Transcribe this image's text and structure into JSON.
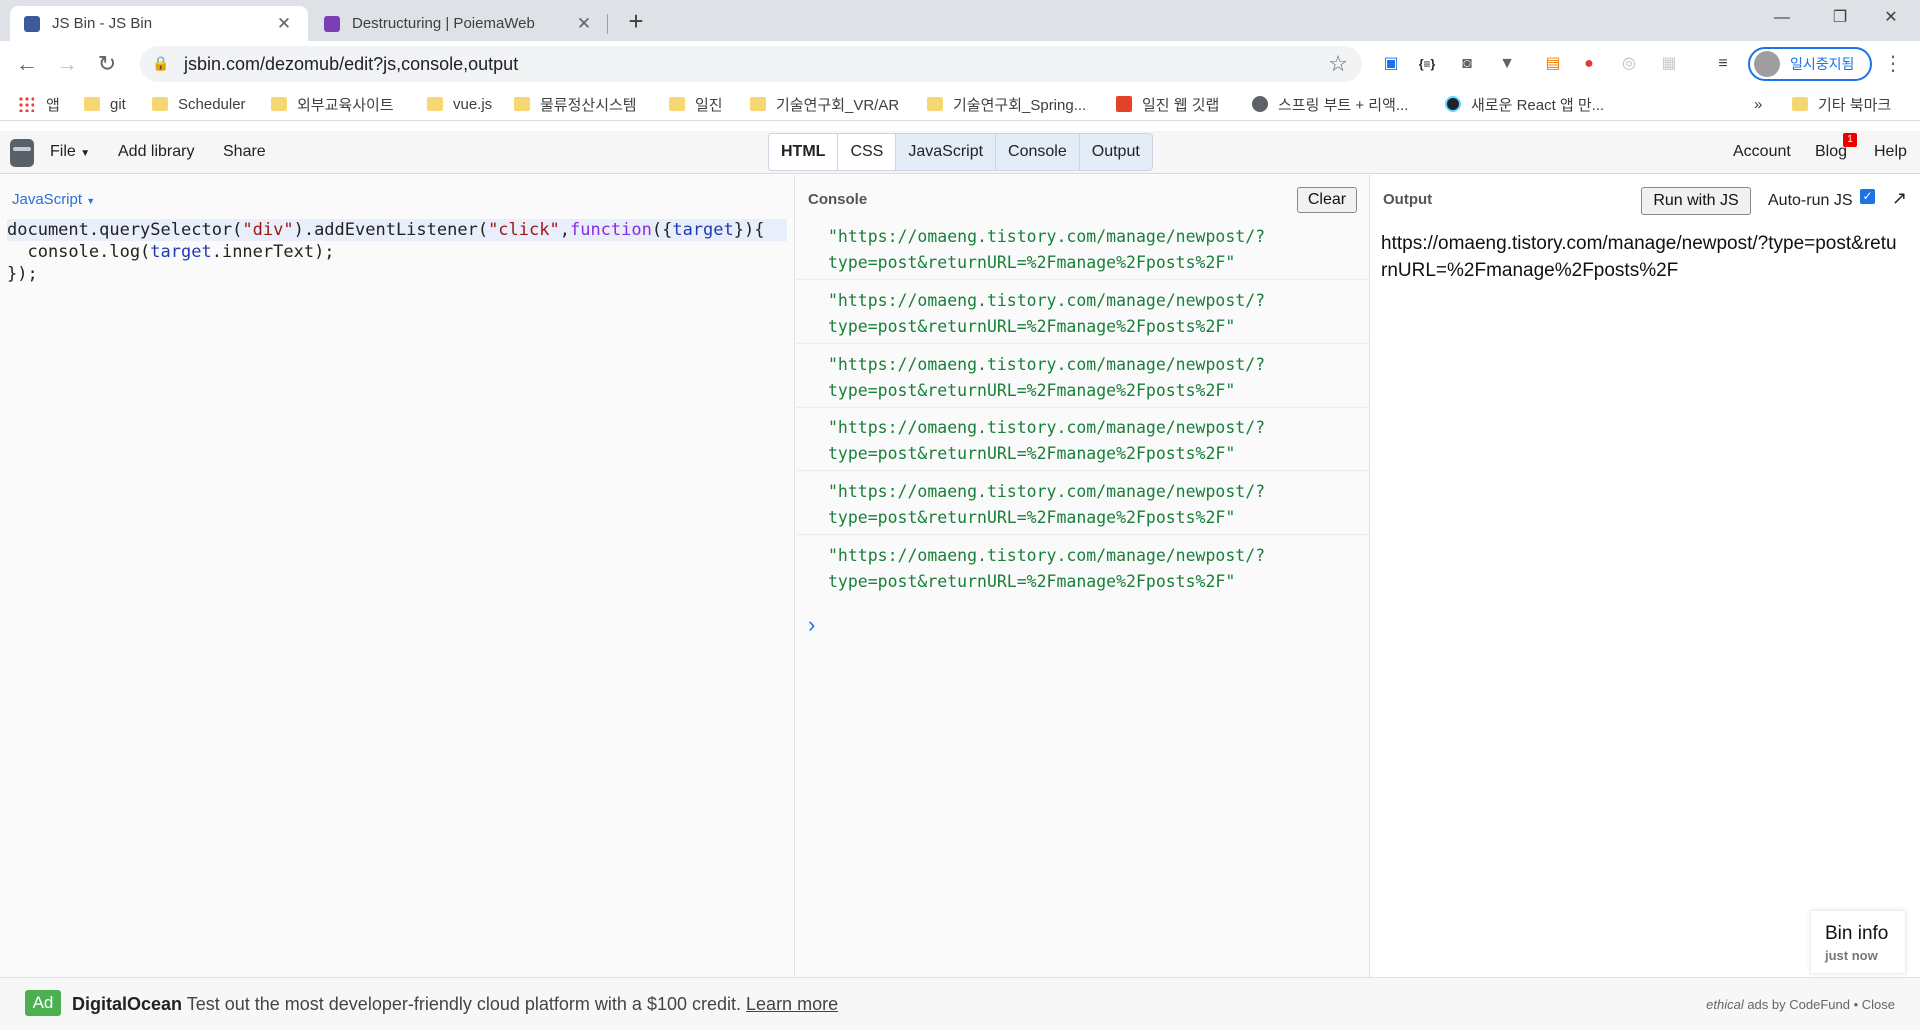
{
  "browser": {
    "tabs": [
      {
        "title": "JS Bin - JS Bin",
        "active": true,
        "favicon_color": "#3c5a99"
      },
      {
        "title": "Destructuring | PoiemaWeb",
        "active": false,
        "favicon_color": "#7b3fb5"
      }
    ],
    "url": "jsbin.com/dezomub/edit?js,console,output",
    "profile_label": "일시중지됨",
    "bookmarks": [
      {
        "label": "앱",
        "type": "apps"
      },
      {
        "label": "git",
        "type": "folder"
      },
      {
        "label": "Scheduler",
        "type": "folder"
      },
      {
        "label": "외부교육사이트",
        "type": "folder"
      },
      {
        "label": "vue.js",
        "type": "folder"
      },
      {
        "label": "물류정산시스템",
        "type": "folder"
      },
      {
        "label": "일진",
        "type": "folder"
      },
      {
        "label": "기술연구회_VR/AR",
        "type": "folder"
      },
      {
        "label": "기술연구회_Spring...",
        "type": "folder"
      },
      {
        "label": "일진 웹 깃랩",
        "type": "gitlab"
      },
      {
        "label": "스프링 부트 + 리액...",
        "type": "globe"
      },
      {
        "label": "새로운 React 앱 만...",
        "type": "react"
      }
    ],
    "bookmarks_overflow": "»",
    "other_bookmarks": "기타 북마크"
  },
  "jsbin": {
    "menu": {
      "file": "File",
      "add_library": "Add library",
      "share": "Share"
    },
    "panels": [
      {
        "label": "HTML",
        "state": "off"
      },
      {
        "label": "CSS",
        "state": "off"
      },
      {
        "label": "JavaScript",
        "state": "on"
      },
      {
        "label": "Console",
        "state": "on"
      },
      {
        "label": "Output",
        "state": "on"
      }
    ],
    "right_menu": {
      "account": "Account",
      "blog": "Blog",
      "blog_badge": "1",
      "help": "Help"
    }
  },
  "editor": {
    "language": "JavaScript",
    "code": {
      "l1_a": "document.querySelector(",
      "l1_s1": "\"div\"",
      "l1_b": ").addEventListener(",
      "l1_s2": "\"click\"",
      "l1_c": ",",
      "l1_kw": "function",
      "l1_d": "({",
      "l1_v": "target",
      "l1_e": "}){",
      "l2_a": "  console.log(",
      "l2_v": "target",
      "l2_b": ".innerText);",
      "l3": "});"
    }
  },
  "console": {
    "label": "Console",
    "clear_label": "Clear",
    "logs": [
      {
        "line1": "\"https://omaeng.tistory.com/manage/newpost/?",
        "line2": "type=post&returnURL=%2Fmanage%2Fposts%2F\""
      },
      {
        "line1": "\"https://omaeng.tistory.com/manage/newpost/?",
        "line2": "type=post&returnURL=%2Fmanage%2Fposts%2F\""
      },
      {
        "line1": "\"https://omaeng.tistory.com/manage/newpost/?",
        "line2": "type=post&returnURL=%2Fmanage%2Fposts%2F\""
      },
      {
        "line1": "\"https://omaeng.tistory.com/manage/newpost/?",
        "line2": "type=post&returnURL=%2Fmanage%2Fposts%2F\""
      },
      {
        "line1": "\"https://omaeng.tistory.com/manage/newpost/?",
        "line2": "type=post&returnURL=%2Fmanage%2Fposts%2F\""
      },
      {
        "line1": "\"https://omaeng.tistory.com/manage/newpost/?",
        "line2": "type=post&returnURL=%2Fmanage%2Fposts%2F\""
      }
    ],
    "prompt": "›"
  },
  "output": {
    "label": "Output",
    "run_label": "Run with JS",
    "autorun_label": "Auto-run JS",
    "autorun_checked": true,
    "text": "https://omaeng.tistory.com/manage/newpost/?type=post&returnURL=%2Fmanage%2Fposts%2F"
  },
  "bin_info": {
    "title": "Bin info",
    "time": "just now"
  },
  "ad": {
    "tag": "Ad",
    "brand": "DigitalOcean",
    "text": "Test out the most developer-friendly cloud platform with a $100 credit.",
    "link": "Learn more",
    "right_em": "ethical",
    "right_text": "ads by CodeFund •",
    "close": "Close"
  }
}
